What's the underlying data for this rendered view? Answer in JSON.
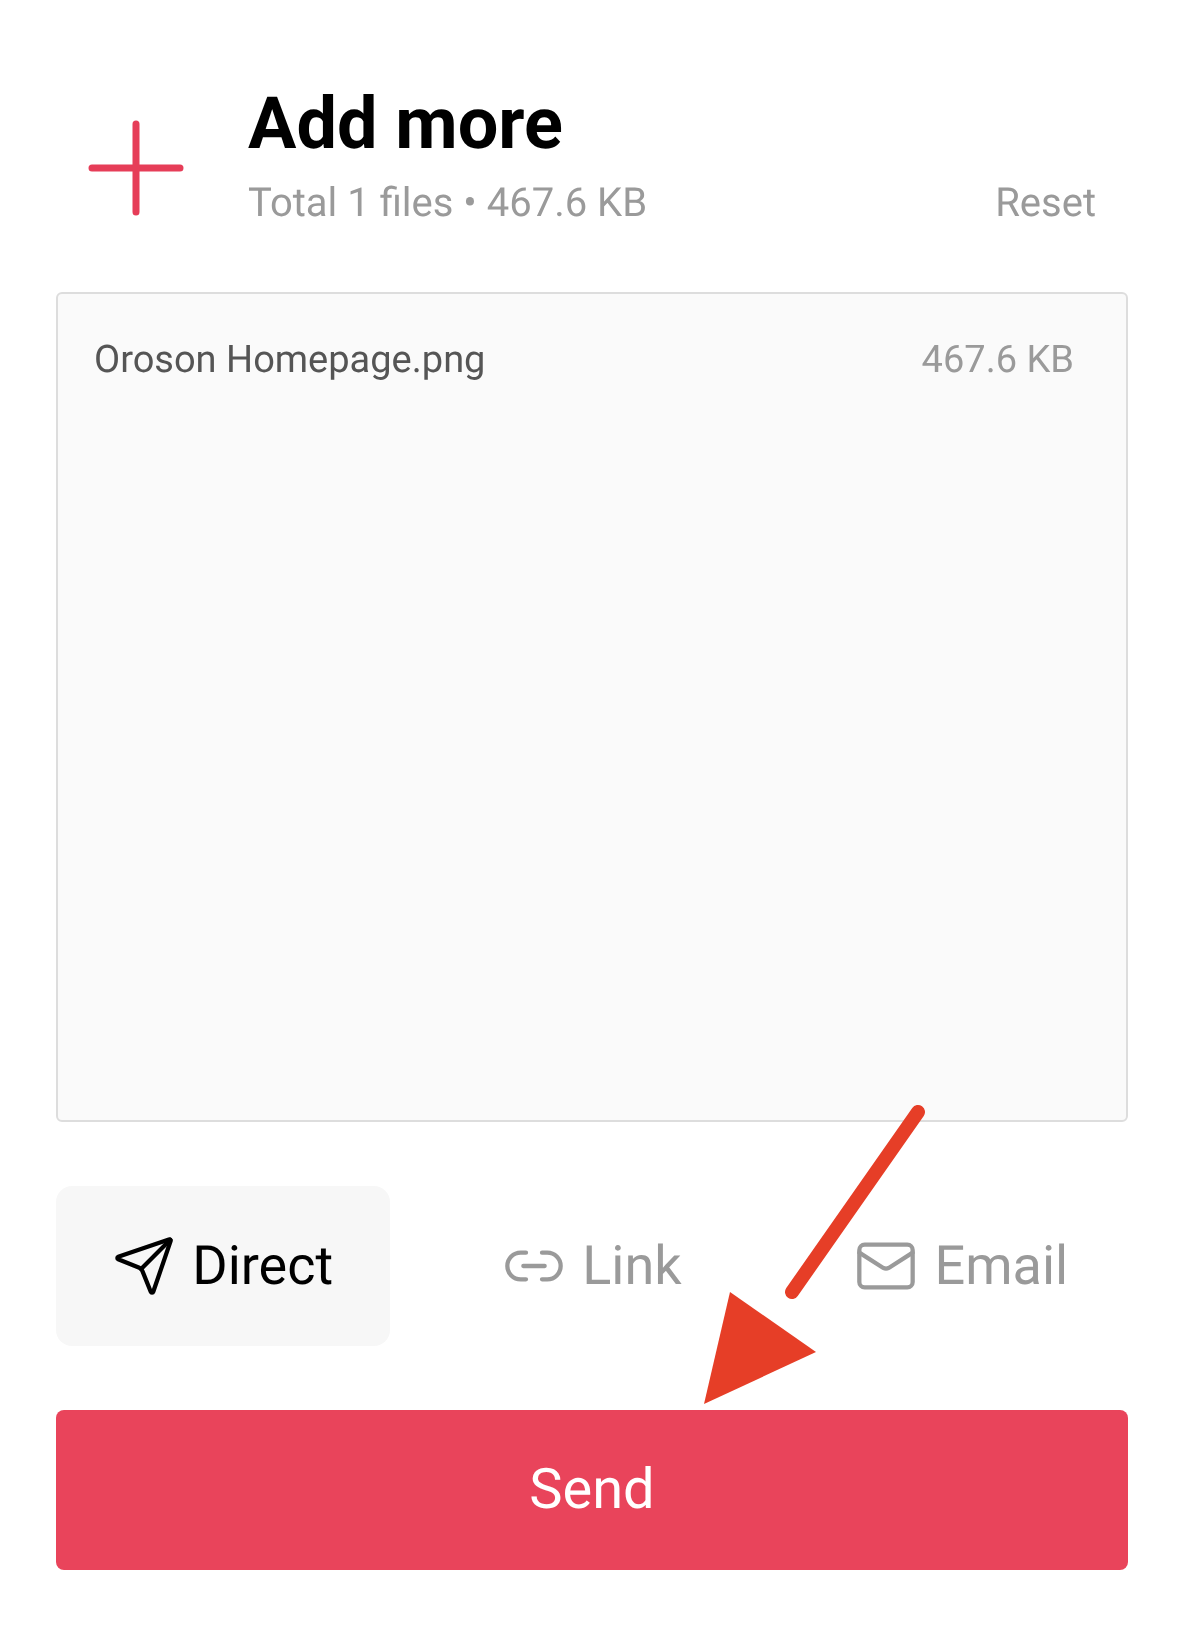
{
  "header": {
    "title": "Add more",
    "summary": "Total 1 files • 467.6 KB",
    "reset": "Reset"
  },
  "files": [
    {
      "name": "Oroson Homepage.png",
      "size": "467.6 KB"
    }
  ],
  "methods": [
    {
      "kind": "direct",
      "label": "Direct",
      "selected": true
    },
    {
      "kind": "link",
      "label": "Link",
      "selected": false
    },
    {
      "kind": "email",
      "label": "Email",
      "selected": false
    }
  ],
  "send_button": "Send"
}
